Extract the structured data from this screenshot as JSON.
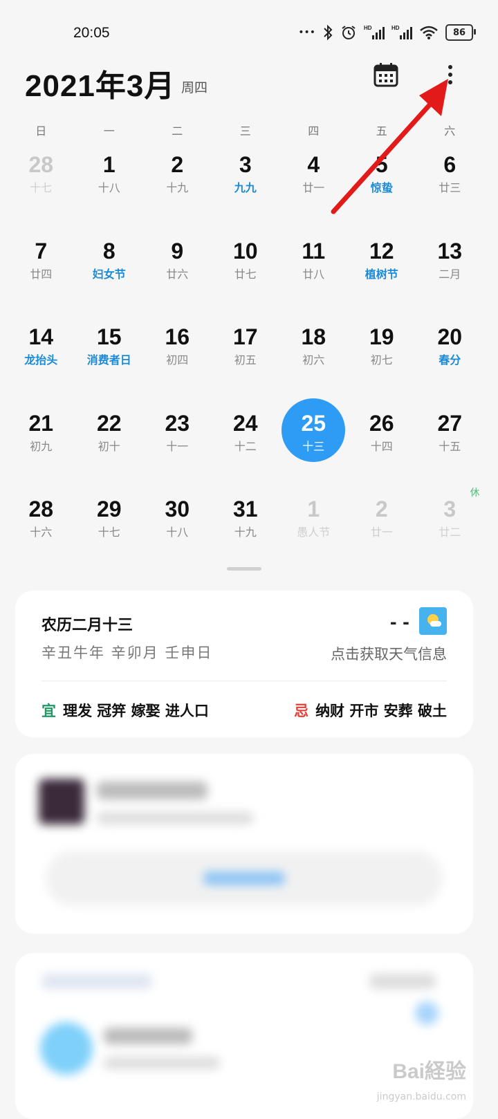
{
  "status_bar": {
    "time": "20:05",
    "battery": "86"
  },
  "header": {
    "title": "2021年3月",
    "weekday": "周四"
  },
  "weekday_labels": [
    "日",
    "一",
    "二",
    "三",
    "四",
    "五",
    "六"
  ],
  "days": [
    {
      "num": "28",
      "sub": "十七",
      "state": "muted"
    },
    {
      "num": "1",
      "sub": "十八",
      "state": "normal"
    },
    {
      "num": "2",
      "sub": "十九",
      "state": "normal"
    },
    {
      "num": "3",
      "sub": "九九",
      "state": "holiday"
    },
    {
      "num": "4",
      "sub": "廿一",
      "state": "normal"
    },
    {
      "num": "5",
      "sub": "惊蛰",
      "state": "holiday"
    },
    {
      "num": "6",
      "sub": "廿三",
      "state": "normal"
    },
    {
      "num": "7",
      "sub": "廿四",
      "state": "normal"
    },
    {
      "num": "8",
      "sub": "妇女节",
      "state": "holiday"
    },
    {
      "num": "9",
      "sub": "廿六",
      "state": "normal"
    },
    {
      "num": "10",
      "sub": "廿七",
      "state": "normal"
    },
    {
      "num": "11",
      "sub": "廿八",
      "state": "normal"
    },
    {
      "num": "12",
      "sub": "植树节",
      "state": "holiday"
    },
    {
      "num": "13",
      "sub": "二月",
      "state": "normal"
    },
    {
      "num": "14",
      "sub": "龙抬头",
      "state": "holiday"
    },
    {
      "num": "15",
      "sub": "消费者日",
      "state": "holiday"
    },
    {
      "num": "16",
      "sub": "初四",
      "state": "normal"
    },
    {
      "num": "17",
      "sub": "初五",
      "state": "normal"
    },
    {
      "num": "18",
      "sub": "初六",
      "state": "normal"
    },
    {
      "num": "19",
      "sub": "初七",
      "state": "normal"
    },
    {
      "num": "20",
      "sub": "春分",
      "state": "holiday"
    },
    {
      "num": "21",
      "sub": "初九",
      "state": "normal"
    },
    {
      "num": "22",
      "sub": "初十",
      "state": "normal"
    },
    {
      "num": "23",
      "sub": "十一",
      "state": "normal"
    },
    {
      "num": "24",
      "sub": "十二",
      "state": "normal"
    },
    {
      "num": "25",
      "sub": "十三",
      "state": "today"
    },
    {
      "num": "26",
      "sub": "十四",
      "state": "normal"
    },
    {
      "num": "27",
      "sub": "十五",
      "state": "normal"
    },
    {
      "num": "28",
      "sub": "十六",
      "state": "normal"
    },
    {
      "num": "29",
      "sub": "十七",
      "state": "normal"
    },
    {
      "num": "30",
      "sub": "十八",
      "state": "normal"
    },
    {
      "num": "31",
      "sub": "十九",
      "state": "normal"
    },
    {
      "num": "1",
      "sub": "愚人节",
      "state": "muted"
    },
    {
      "num": "2",
      "sub": "廿一",
      "state": "muted"
    },
    {
      "num": "3",
      "sub": "廿二",
      "state": "muted",
      "badge": "休"
    }
  ],
  "lunar_card": {
    "lunar_date": "农历二月十三",
    "ganzhi": "辛丑牛年 辛卯月 壬申日",
    "weather_dash": "- -",
    "weather_hint": "点击获取天气信息",
    "yi_label": "宜",
    "yi_items": "理发 冠笄 嫁娶 进人口",
    "ji_label": "忌",
    "ji_items": "纳财 开市 安葬 破土"
  },
  "colors": {
    "accent": "#2e9cf4",
    "holiday": "#1b8ad6",
    "yi": "#1d9a63",
    "ji": "#e0413a"
  },
  "icons": [
    "more-icon",
    "calendar-icon",
    "bluetooth-icon",
    "alarm-icon",
    "wifi-icon",
    "signal-icon"
  ],
  "watermark": {
    "brand": "Bai経验",
    "url": "jingyan.baidu.com"
  }
}
